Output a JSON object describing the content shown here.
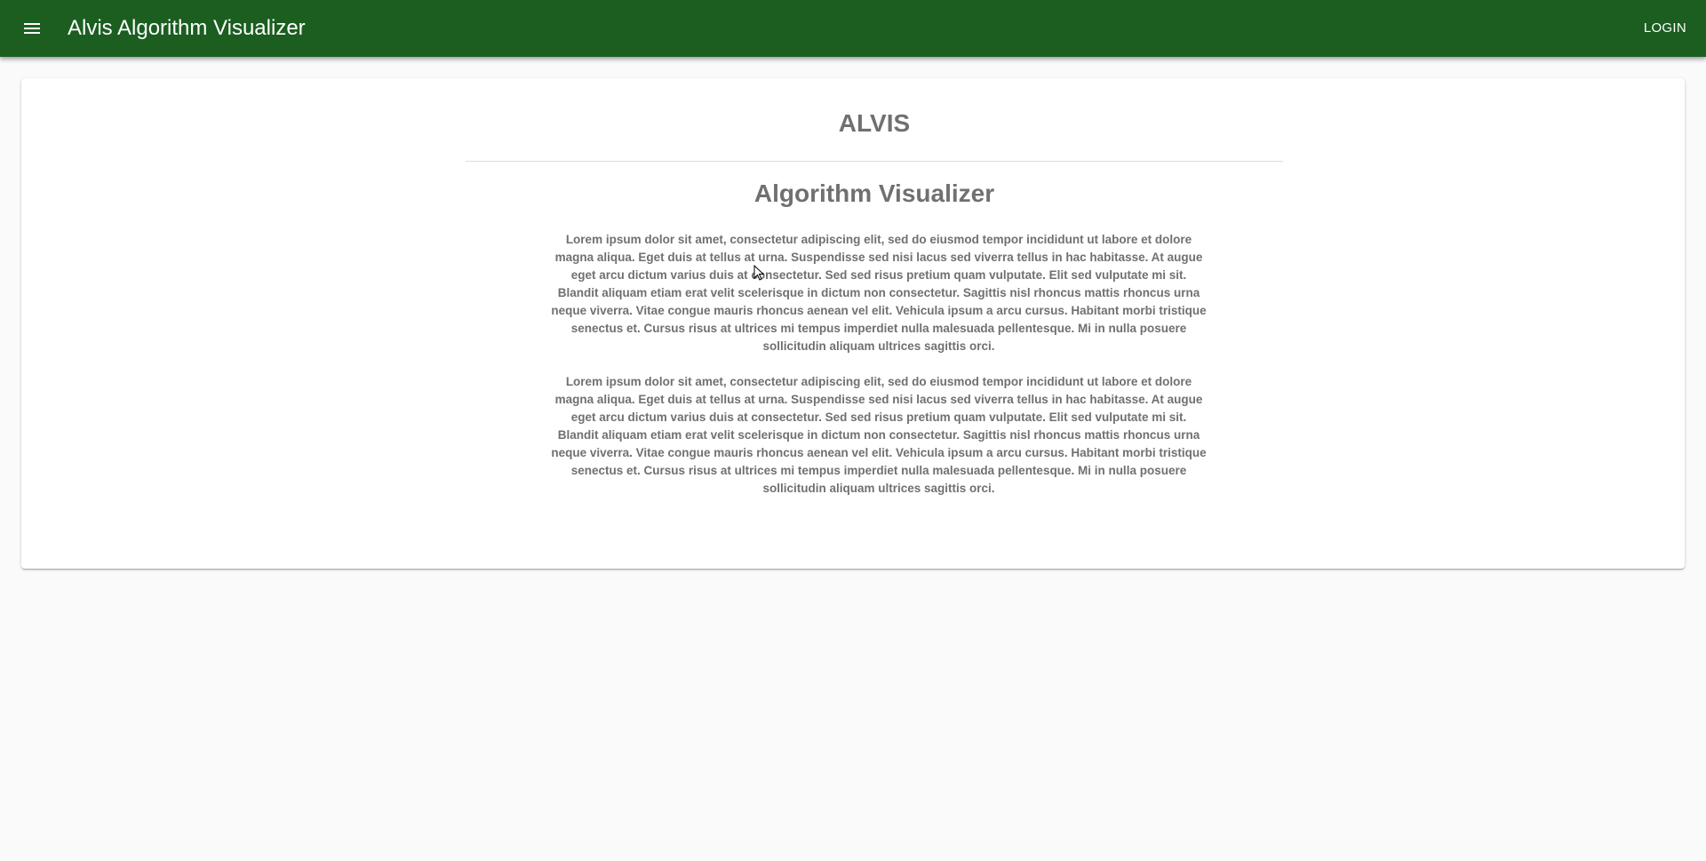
{
  "header": {
    "menu_icon": "menu-icon",
    "title": "Alvis Algorithm Visualizer",
    "login_label": "LOGIN",
    "background_color": "#1b5e20"
  },
  "main": {
    "brand": "ALVIS",
    "subtitle": "Algorithm Visualizer",
    "paragraphs": [
      "Lorem ipsum dolor sit amet, consectetur adipiscing elit, sed do eiusmod tempor incididunt ut labore et dolore magna aliqua. Eget duis at tellus at urna. Suspendisse sed nisi lacus sed viverra tellus in hac habitasse. At augue eget arcu dictum varius duis at consectetur. Sed sed risus pretium quam vulputate. Elit sed vulputate mi sit. Blandit aliquam etiam erat velit scelerisque in dictum non consectetur. Sagittis nisl rhoncus mattis rhoncus urna neque viverra. Vitae congue mauris rhoncus aenean vel elit. Vehicula ipsum a arcu cursus. Habitant morbi tristique senectus et. Cursus risus at ultrices mi tempus imperdiet nulla malesuada pellentesque. Mi in nulla posuere sollicitudin aliquam ultrices sagittis orci.",
      "Lorem ipsum dolor sit amet, consectetur adipiscing elit, sed do eiusmod tempor incididunt ut labore et dolore magna aliqua. Eget duis at tellus at urna. Suspendisse sed nisi lacus sed viverra tellus in hac habitasse. At augue eget arcu dictum varius duis at consectetur. Sed sed risus pretium quam vulputate. Elit sed vulputate mi sit. Blandit aliquam etiam erat velit scelerisque in dictum non consectetur. Sagittis nisl rhoncus mattis rhoncus urna neque viverra. Vitae congue mauris rhoncus aenean vel elit. Vehicula ipsum a arcu cursus. Habitant morbi tristique senectus et. Cursus risus at ultrices mi tempus imperdiet nulla malesuada pellentesque. Mi in nulla posuere sollicitudin aliquam ultrices sagittis orci."
    ]
  }
}
